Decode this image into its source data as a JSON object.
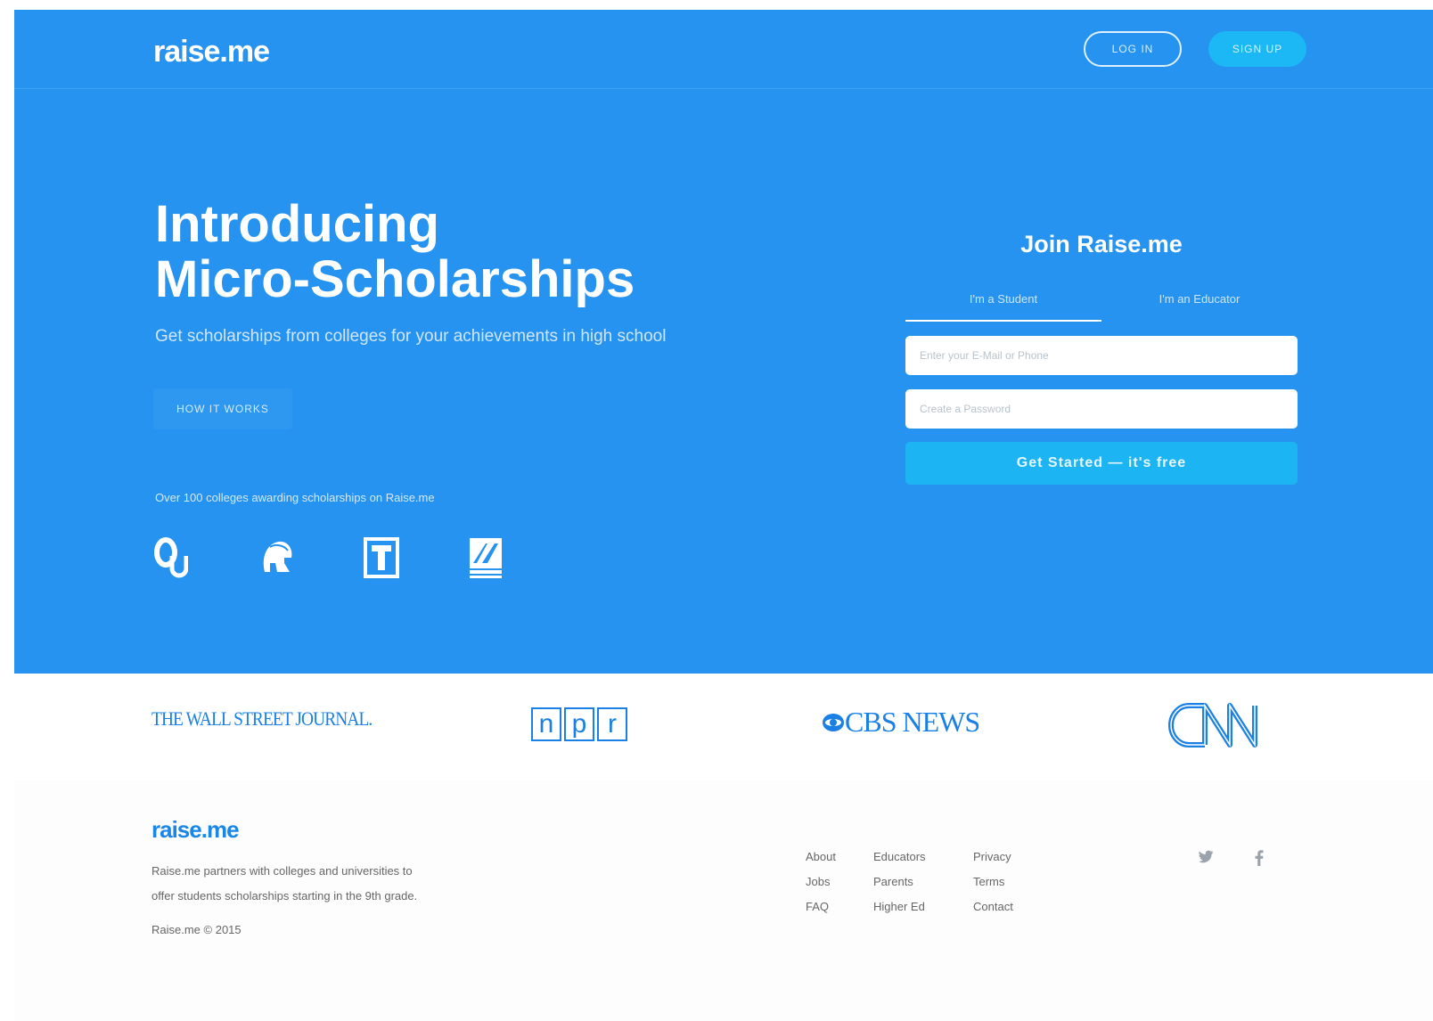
{
  "header": {
    "logo": "raise.me",
    "login_label": "LOG IN",
    "signup_label": "SIGN UP"
  },
  "hero": {
    "headline_line1": "Introducing",
    "headline_line2": "Micro-Scholarships",
    "subheadline": "Get scholarships from colleges for your achievements in high school",
    "how_it_works_label": "HOW IT WORKS",
    "colleges_caption": "Over 100 colleges awarding scholarships on Raise.me",
    "college_logos": [
      "ou-logo-icon",
      "spartan-helmet-icon",
      "temple-t-icon",
      "umass-logo-icon"
    ]
  },
  "join": {
    "title": "Join Raise.me",
    "tabs": [
      "I'm a Student",
      "I'm an Educator"
    ],
    "email_placeholder": "Enter your E-Mail or Phone",
    "password_placeholder": "Create a Password",
    "submit_label": "Get Started — it's free"
  },
  "press": {
    "wsj": "THE WALL STREET JOURNAL.",
    "npr": [
      "n",
      "p",
      "r"
    ],
    "cbs": "CBS NEWS",
    "cnn": "CNN"
  },
  "footer": {
    "logo": "raise.me",
    "description_line1": "Raise.me partners with colleges and universities to",
    "description_line2": "offer students scholarships starting in the 9th grade.",
    "copyright": "Raise.me © 2015",
    "links": [
      [
        "About",
        "Jobs",
        "FAQ"
      ],
      [
        "Educators",
        "Parents",
        "Higher Ed"
      ],
      [
        "Privacy",
        "Terms",
        "Contact"
      ]
    ],
    "social": [
      "twitter-icon",
      "facebook-icon"
    ]
  },
  "colors": {
    "hero_bg": "#2693f0",
    "accent": "#1cb4f2",
    "press_blue": "#1a80e6"
  }
}
